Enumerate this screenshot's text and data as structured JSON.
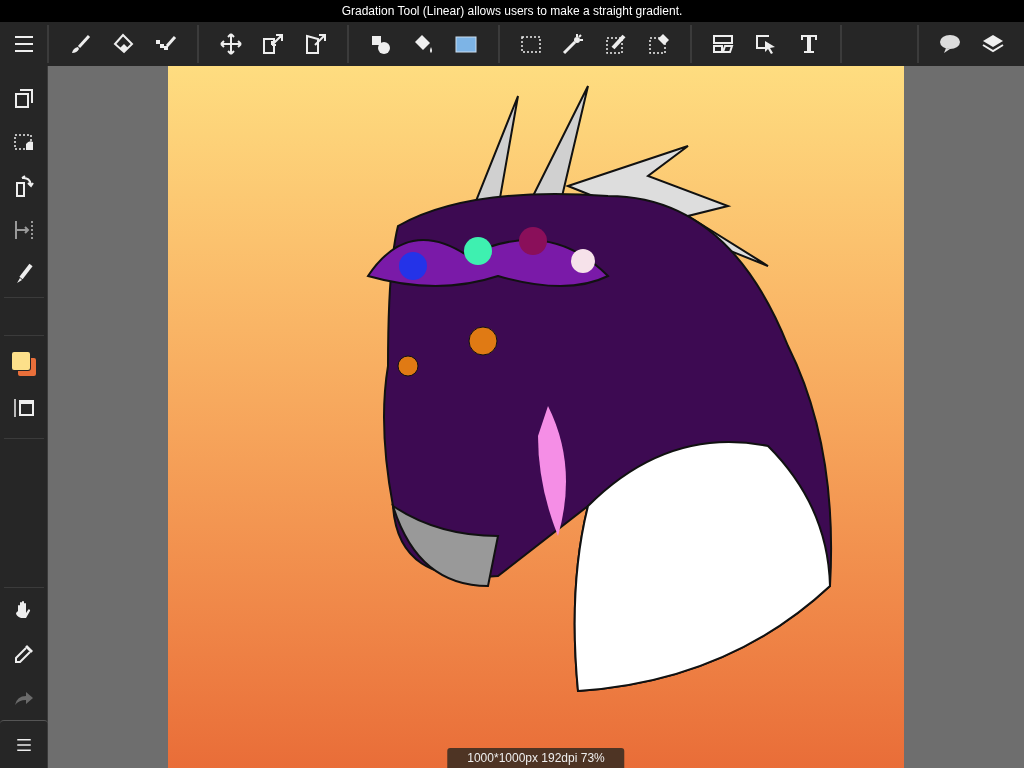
{
  "tooltip": "Gradation Tool (Linear) allows users to make a straight gradient.",
  "color_swatches": [
    {
      "kind": "primary",
      "color": "#fde08a"
    },
    {
      "kind": "secondary",
      "color": "#ea6f3a"
    }
  ],
  "redo": {
    "disabled": true
  },
  "canvas_info": "1000*1000px 192dpi 73%"
}
